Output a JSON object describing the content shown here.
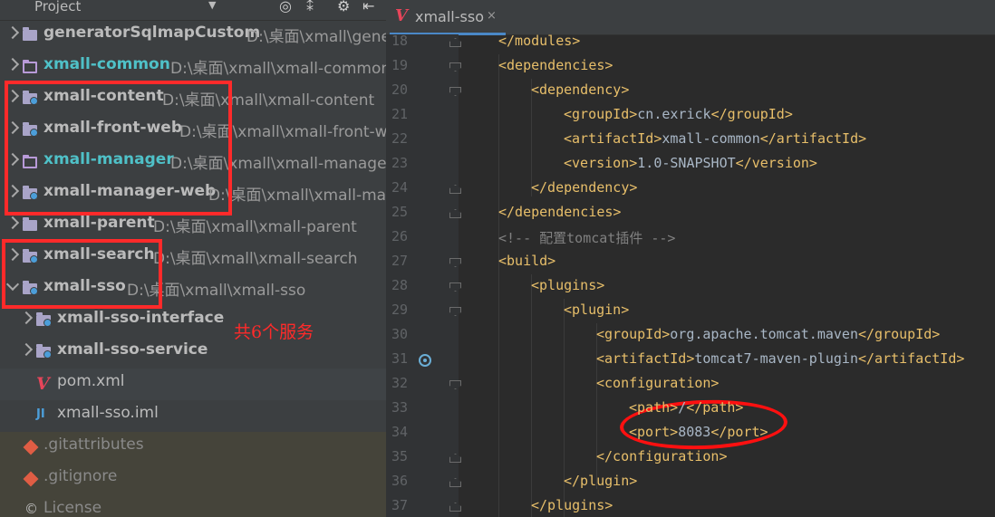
{
  "project_panel": {
    "title": "Project",
    "header_icons": [
      "target-icon",
      "collapse-icon",
      "settings-icon",
      "hide-icon"
    ],
    "tree": [
      {
        "name": "generatorSqlmapCustom",
        "path": "D:\\桌面\\xmall\\generatorSqlmapCustom"
      },
      {
        "name": "xmall-common",
        "path": "D:\\桌面\\xmall\\xmall-common"
      },
      {
        "name": "xmall-content",
        "path": "D:\\桌面\\xmall\\xmall-content"
      },
      {
        "name": "xmall-front-web",
        "path": "D:\\桌面\\xmall\\xmall-front-web"
      },
      {
        "name": "xmall-manager",
        "path": "D:\\桌面\\xmall\\xmall-manager"
      },
      {
        "name": "xmall-manager-web",
        "path": "D:\\桌面\\xmall\\xmall-manager-web"
      },
      {
        "name": "xmall-parent",
        "path": "D:\\桌面\\xmall\\xmall-parent"
      },
      {
        "name": "xmall-search",
        "path": "D:\\桌面\\xmall\\xmall-search"
      },
      {
        "name": "xmall-sso",
        "path": "D:\\桌面\\xmall\\xmall-sso"
      },
      {
        "name": "xmall-sso-interface",
        "path": ""
      },
      {
        "name": "xmall-sso-service",
        "path": ""
      },
      {
        "name": "pom.xml",
        "path": ""
      },
      {
        "name": "xmall-sso.iml",
        "path": ""
      },
      {
        "name": ".gitattributes",
        "path": ""
      },
      {
        "name": ".gitignore",
        "path": ""
      },
      {
        "name": "License",
        "path": ""
      }
    ],
    "annotation": "共6个服务"
  },
  "editor": {
    "tab_label": "xmall-sso",
    "tab_close": "×",
    "lines": [
      {
        "num": "18",
        "code": "</modules>"
      },
      {
        "num": "19",
        "code": "<dependencies>"
      },
      {
        "num": "20",
        "code": "<dependency>"
      },
      {
        "num": "21",
        "code": "<groupId>cn.exrick</groupId>"
      },
      {
        "num": "22",
        "code": "<artifactId>xmall-common</artifactId>"
      },
      {
        "num": "23",
        "code": "<version>1.0-SNAPSHOT</version>"
      },
      {
        "num": "24",
        "code": "</dependency>"
      },
      {
        "num": "25",
        "code": "</dependencies>"
      },
      {
        "num": "26",
        "code": "<!-- 配置tomcat插件 -->"
      },
      {
        "num": "27",
        "code": "<build>"
      },
      {
        "num": "28",
        "code": "<plugins>"
      },
      {
        "num": "29",
        "code": "<plugin>"
      },
      {
        "num": "30",
        "code": "<groupId>org.apache.tomcat.maven</groupId>"
      },
      {
        "num": "31",
        "code": "<artifactId>tomcat7-maven-plugin</artifactId>"
      },
      {
        "num": "32",
        "code": "<configuration>"
      },
      {
        "num": "33",
        "code": "<path>/</path>"
      },
      {
        "num": "34",
        "code": "<port>8083</port>"
      },
      {
        "num": "35",
        "code": "</configuration>"
      },
      {
        "num": "36",
        "code": "</plugin>"
      },
      {
        "num": "37",
        "code": "</plugins>"
      }
    ]
  },
  "colors": {
    "highlight_box": "#ff2a2a",
    "tag": "#e8bf6a",
    "comment": "#808080",
    "module_name_active": "#4fc1c8"
  }
}
